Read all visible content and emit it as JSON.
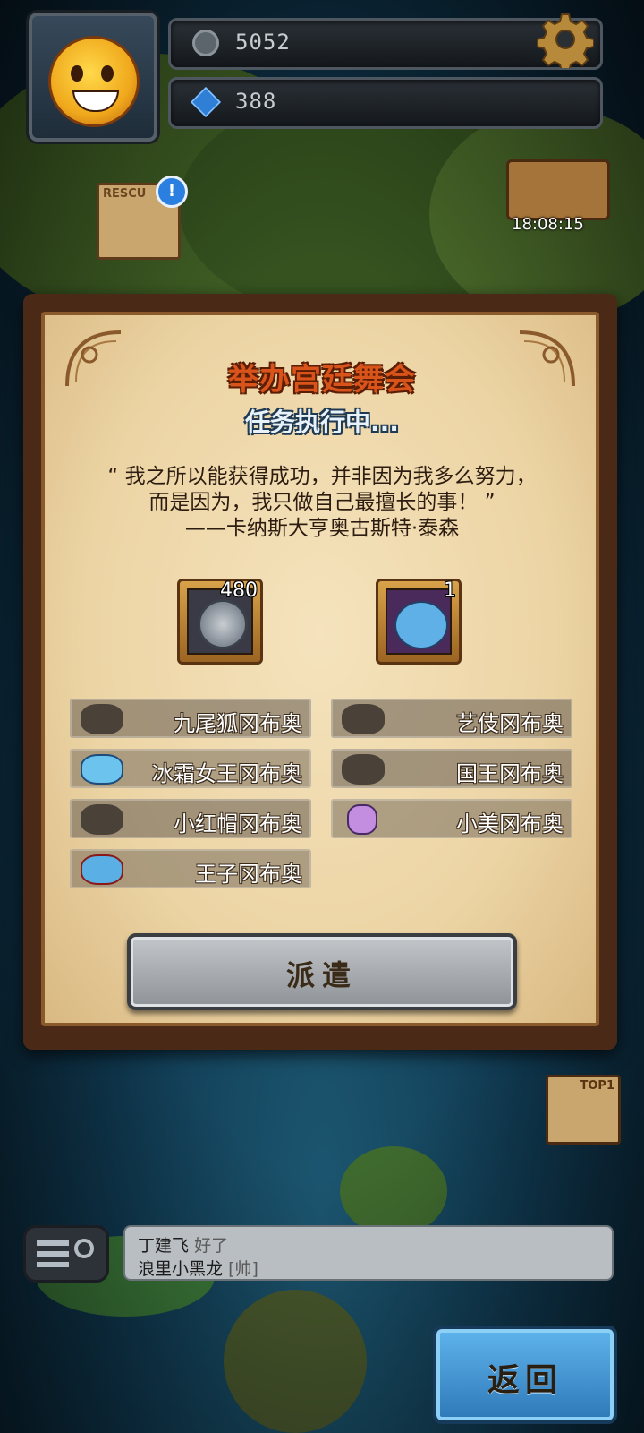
{
  "hud": {
    "coins": "5052",
    "gems": "388",
    "icons": [
      "coin-icon",
      "gem-icon",
      "gear-icon"
    ]
  },
  "map": {
    "rescue_label": "RESCU",
    "rescue_badge": "!",
    "chest_timer": "18:08:15",
    "top_badge": "TOP1"
  },
  "mission": {
    "title": "举办宫廷舞会",
    "status": "任务执行中...",
    "quote_line1": "“ 我之所以能获得成功，并非因为我多么努力，",
    "quote_line2": "而是因为，我只做自己最擅长的事！ ”",
    "quote_author": "——卡纳斯大亨奥古斯特·泰森",
    "rewards": [
      {
        "icon": "helmet-coin-icon",
        "count": "480"
      },
      {
        "icon": "ice-queen-icon",
        "count": "1"
      }
    ],
    "heroes": [
      {
        "name": "九尾狐冈布奥",
        "owned": false
      },
      {
        "name": "艺伎冈布奥",
        "owned": false
      },
      {
        "name": "冰霜女王冈布奥",
        "owned": true
      },
      {
        "name": "国王冈布奥",
        "owned": false
      },
      {
        "name": "小红帽冈布奥",
        "owned": false
      },
      {
        "name": "小美冈布奥",
        "owned": true
      },
      {
        "name": "王子冈布奥",
        "owned": true
      }
    ],
    "dispatch_label": "派遣"
  },
  "chat": {
    "line1_name": "丁建飞",
    "line1_msg": "好了",
    "line2_name": "浪里小黑龙",
    "line2_msg": "[帅]"
  },
  "back_label": "返回",
  "colors": {
    "title": "#d9541a",
    "status": "#e8f2fa",
    "parchment": "#ecd4a4",
    "frame": "#4a2a16",
    "back_button": "#3a8fd0"
  }
}
